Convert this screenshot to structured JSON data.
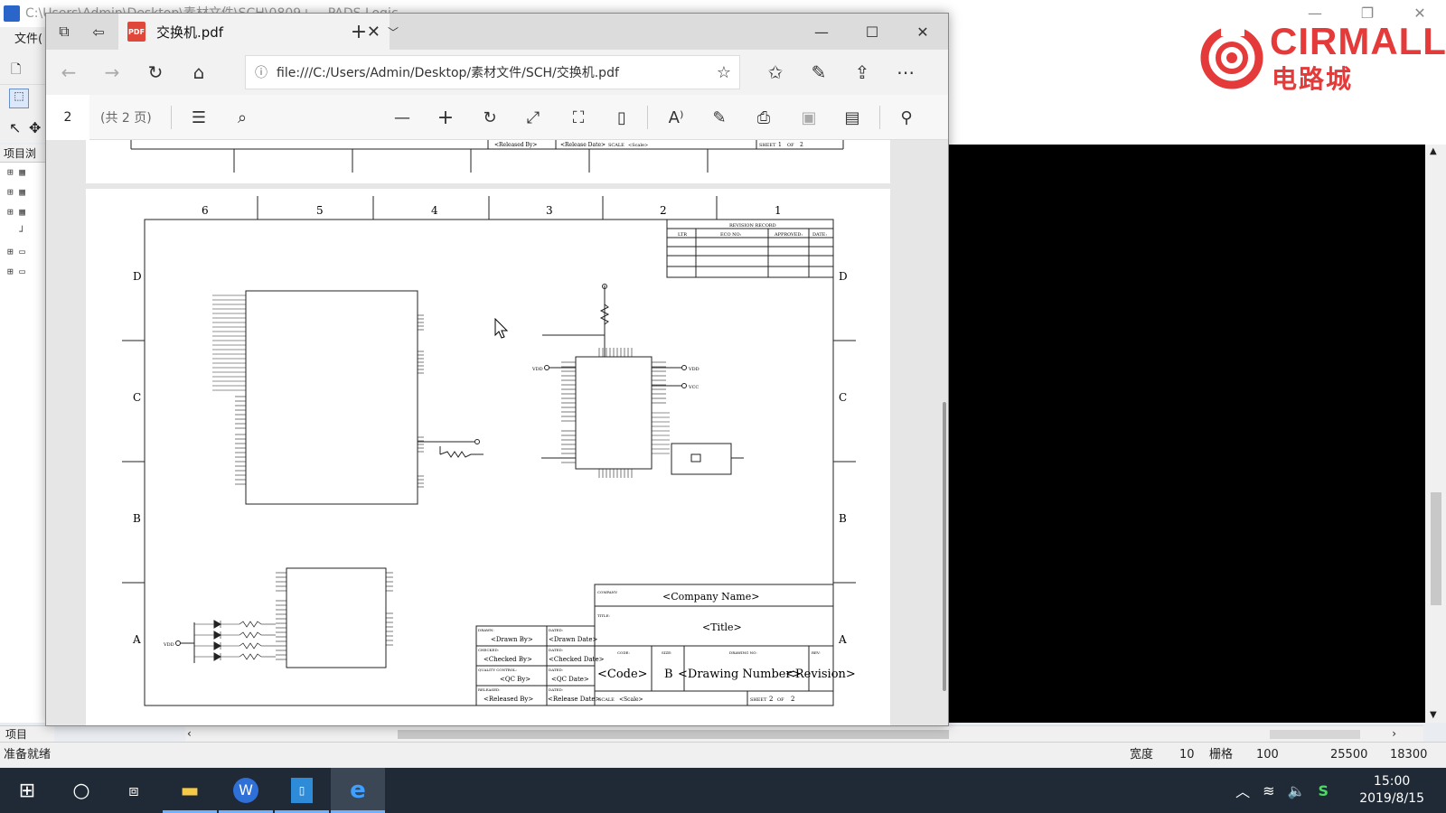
{
  "pads": {
    "title": "C:\\Users\\Admin\\Desktop\\素材文件\\SCH\\0809+... PADS Logic",
    "menu_file": "文件(",
    "project_panel": "项目浏",
    "project_tab": "项目",
    "status": {
      "ready": "准备就绪",
      "width_label": "宽度",
      "width_value": "10",
      "grid_label": "栅格",
      "grid_value": "100",
      "x": "25500",
      "y": "18300"
    }
  },
  "logo": {
    "name": "CIRMALL",
    "sub": "电路城"
  },
  "edge": {
    "tab_title": "交换机.pdf",
    "url": "file:///C:/Users/Admin/Desktop/素材文件/SCH/交换机.pdf",
    "page_number": "2",
    "page_count": "(共 2 页)"
  },
  "schematic": {
    "cols": [
      "6",
      "5",
      "4",
      "3",
      "2",
      "1"
    ],
    "rows": [
      "D",
      "C",
      "B",
      "A"
    ],
    "revision_record": "REVISION RECORD",
    "rev_cols": [
      "LTR",
      "ECO NO:",
      "APPROVED:",
      "DATE:"
    ],
    "company_label": "COMPANY:",
    "company": "<Company Name>",
    "title_label": "TITLE:",
    "title": "<Title>",
    "code_label": "CODE:",
    "code": "<Code>",
    "size_label": "SIZE:",
    "size": "B",
    "drawing_label": "DRAWING NO:",
    "drawing": "<Drawing Number>",
    "rev_label": "REV:",
    "revision": "<Revision>",
    "drawn_label": "DRAWN:",
    "drawn": "<Drawn By>",
    "drawn_date": "<Drawn Date>",
    "checked_label": "CHECKED:",
    "checked": "<Checked By>",
    "checked_date": "<Checked Date>",
    "qc_label": "QUALITY CONTROL:",
    "qc": "<QC By>",
    "qc_date": "<QC Date>",
    "released_label": "RELEASED:",
    "released": "<Released By>",
    "release_date": "<Release Date>",
    "dated_label": "DATED:",
    "scale_label": "SCALE",
    "scale": "<Scale>",
    "sheet_label": "SHEET",
    "sheet": "2",
    "of_label": "OF",
    "sheet_total": "2",
    "prev_sheet": "1",
    "vdd": "VDD",
    "vcc": "VCC"
  },
  "clock": {
    "time": "15:00",
    "date": "2019/8/15"
  }
}
